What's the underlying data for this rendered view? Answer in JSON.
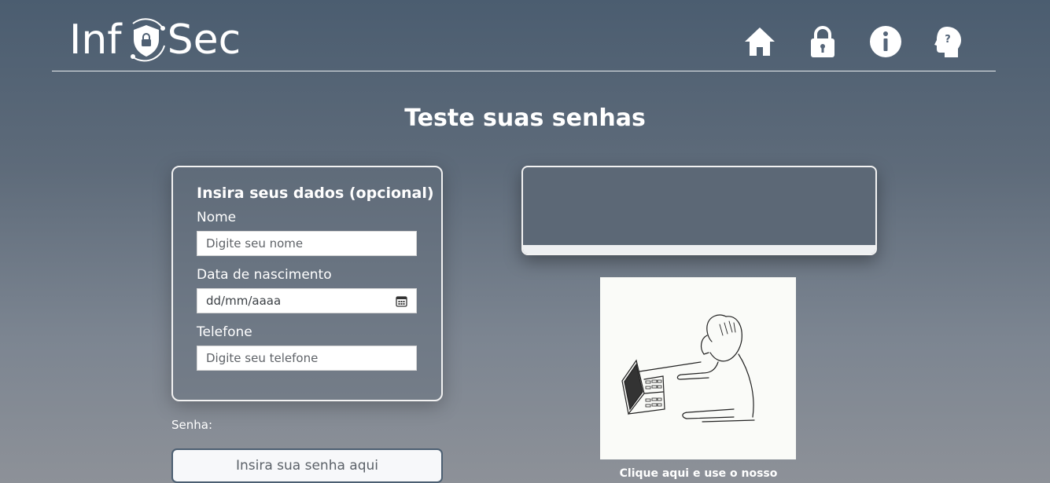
{
  "header": {
    "logo": {
      "text_before": "Inf",
      "text_after": "Sec"
    },
    "nav": [
      {
        "name": "home",
        "icon": "home-icon"
      },
      {
        "name": "lock",
        "icon": "lock-icon"
      },
      {
        "name": "info",
        "icon": "info-icon"
      },
      {
        "name": "help",
        "icon": "head-question-icon"
      }
    ]
  },
  "main": {
    "title": "Teste suas senhas"
  },
  "form": {
    "heading": "Insira seus dados (opcional)",
    "name_label": "Nome",
    "name_placeholder": "Digite seu nome",
    "birth_label": "Data de nascimento",
    "birth_value": "dd/mm/aaaa",
    "phone_label": "Telefone",
    "phone_placeholder": "Digite seu telefone"
  },
  "password": {
    "label": "Senha:",
    "placeholder": "Insira sua senha aqui"
  },
  "comic": {
    "caption": "Clique aqui e use o nosso"
  },
  "colors": {
    "accent": "#4c5f72",
    "text": "#ffffff"
  }
}
